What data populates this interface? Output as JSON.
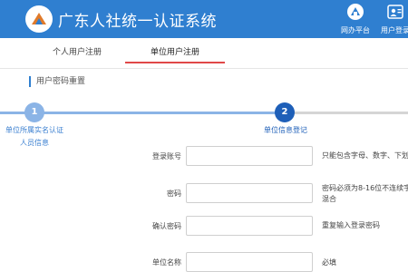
{
  "header": {
    "title": "广东人社统一认证系统",
    "nav_buttons": [
      {
        "label": "网办平台",
        "icon": "a-logo-icon"
      },
      {
        "label": "用户登录",
        "icon": "user-card-icon"
      }
    ]
  },
  "tabs": [
    {
      "label": "个人用户注册",
      "active": false
    },
    {
      "label": "单位用户注册",
      "active": true
    }
  ],
  "section_title": "用户密码重置",
  "steps": [
    {
      "number": "1",
      "label_lines": [
        "单位所属实名认证",
        "人员信息"
      ],
      "color": "#8bb4e6"
    },
    {
      "number": "2",
      "label_lines": [
        "单位信息登记"
      ],
      "color": "#1e5fb8"
    }
  ],
  "form": {
    "fields": [
      {
        "label": "登录账号",
        "value": "",
        "hint_lines": [
          "只能包含字母、数字、下划"
        ]
      },
      {
        "label": "密码",
        "value": "",
        "hint_lines": [
          "密码必须为8-16位不连续字",
          "混合"
        ]
      },
      {
        "label": "确认密码",
        "value": "",
        "hint_lines": [
          "重复输入登录密码"
        ]
      },
      {
        "label": "单位名称",
        "value": "",
        "hint_lines": [
          "必填"
        ]
      }
    ]
  },
  "colors": {
    "header_bg": "#2f7fd0",
    "tab_active_underline": "#e04848",
    "step_done": "#8bb4e6",
    "step_current": "#1e5fb8"
  }
}
